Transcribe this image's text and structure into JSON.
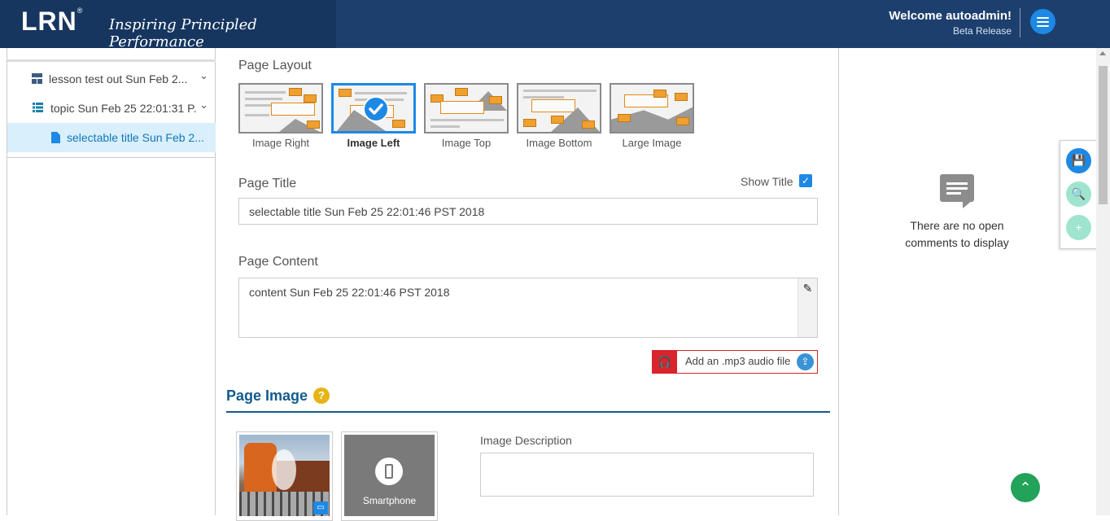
{
  "header": {
    "logo": "LRN",
    "logo_mark": "®",
    "tagline": "Inspiring Principled Performance",
    "welcome": "Welcome autoadmin!",
    "release": "Beta Release"
  },
  "sidebar": {
    "items": [
      {
        "label": "lesson test out Sun Feb 2...",
        "icon": "lesson-grid-icon",
        "chevron": "⌄"
      },
      {
        "label": "topic Sun Feb 25 22:01:31 P...",
        "icon": "topic-list-icon",
        "chevron": "⌄"
      },
      {
        "label": "selectable title Sun Feb 2...",
        "icon": "page-file-icon"
      }
    ]
  },
  "main": {
    "layout_label": "Page Layout",
    "layouts": [
      {
        "label": "Image Right"
      },
      {
        "label": "Image Left",
        "selected": true
      },
      {
        "label": "Image Top"
      },
      {
        "label": "Image Bottom"
      },
      {
        "label": "Large Image"
      }
    ],
    "title_label": "Page Title",
    "show_title_label": "Show Title",
    "show_title_checked": "✓",
    "title_value": "selectable title Sun Feb 25 22:01:46 PST 2018",
    "content_label": "Page Content",
    "content_value": "content Sun Feb 25 22:01:46 PST 2018",
    "content_edit_icon": "✎",
    "audio_label": "Add an .mp3 audio file",
    "audio_icon": "🎧",
    "upload_icon": "⇪",
    "page_image_title": "Page Image",
    "help": "?",
    "phone_label": "Smartphone",
    "monitor_icon": "▭",
    "image_description_label": "Image Description"
  },
  "comments": {
    "empty_text": "There are no open comments to display"
  },
  "toolbar": {
    "save_icon": "💾",
    "preview_icon": "🔍",
    "add_icon": "+",
    "scroll_top_icon": "⌃"
  },
  "colors": {
    "header_bg": "#1c3f6e",
    "accent": "#1e88e5",
    "audio_red": "#d9232d",
    "section_blue": "#135b8e"
  }
}
